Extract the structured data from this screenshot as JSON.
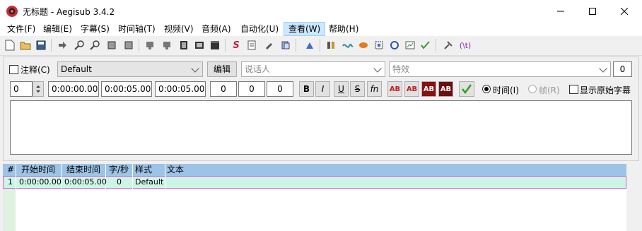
{
  "window": {
    "title": "无标题 - Aegisub 3.4.2",
    "controls": [
      "–",
      "☐",
      "✕"
    ]
  },
  "menu": {
    "items": [
      "文件(F)",
      "编辑(E)",
      "字幕(S)",
      "时间轴(T)",
      "视频(V)",
      "音频(A)",
      "自动化(U)",
      "查看(W)",
      "帮助(H)"
    ],
    "active_index": 7
  },
  "toolbar": {
    "icons": [
      "new-file-icon",
      "open-folder-icon",
      "save-icon",
      "jump-to-icon",
      "zoom-in-icon",
      "zoom-out-icon",
      "video-detach-icon",
      "video-save-icon",
      "audio-open-icon",
      "audio-close-icon",
      "film-icon",
      "film-strip-icon",
      "clapboard-icon",
      "styles-icon",
      "properties-icon",
      "attachments-icon",
      "fonts-collector-icon",
      "automation-icon",
      "spellcheck-icon",
      "timing-post-icon",
      "kanji-timer-icon",
      "shift-times-icon",
      "resample-icon",
      "dummy-video-icon",
      "visual-typesetting-icon",
      "options-icon",
      "hotkeys-icon",
      "macro-icon"
    ]
  },
  "edit": {
    "comment_label": "注释(C)",
    "style_value": "Default",
    "edit_button": "编辑",
    "actor_placeholder": "说话人",
    "effect_placeholder": "特效",
    "layer_value": "0",
    "spin_value": "0",
    "start_time": "0:00:00.00",
    "end_time": "0:00:05.00",
    "duration": "0:00:05.00",
    "margin_left": "0",
    "margin_right": "0",
    "margin_vert": "0",
    "format_buttons": [
      "B",
      "I",
      "U",
      "S",
      "fn"
    ],
    "color_buttons": [
      "AB",
      "AB",
      "AB",
      "AB"
    ],
    "commit_icon": "checkmark-icon",
    "radio_time": "时间(I)",
    "radio_frame": "帧(R)",
    "show_original": "显示原始字幕"
  },
  "grid": {
    "headers": [
      "#",
      "开始时间",
      "结束时间",
      "字/秒",
      "样式",
      "文本"
    ],
    "rows": [
      {
        "num": "1",
        "start": "0:00:00.00",
        "end": "0:00:05.00",
        "cps": "0",
        "style": "Default",
        "text": ""
      }
    ]
  },
  "colors": {
    "grid_header": "#9dc3e6",
    "row_selected": "#cdf5e6",
    "row_border": "#d15fd1",
    "menu_active": "#cce8ff"
  }
}
